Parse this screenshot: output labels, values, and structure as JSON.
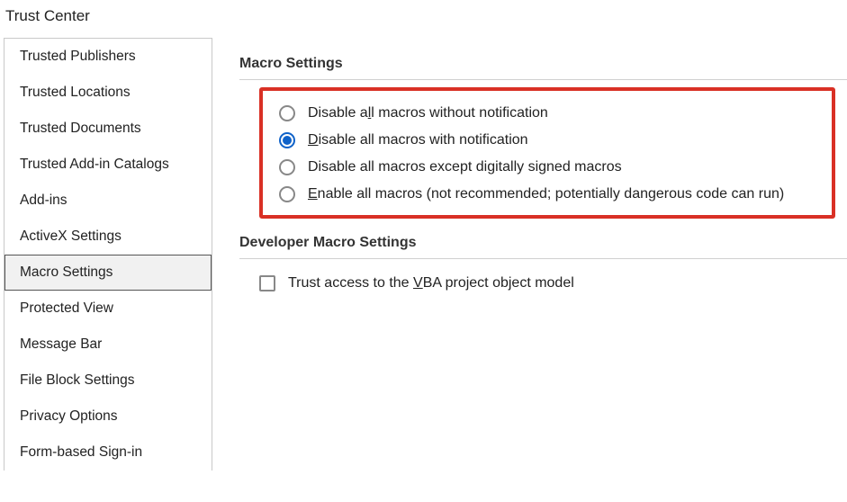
{
  "header": {
    "title": "Trust Center"
  },
  "sidebar": {
    "items": [
      {
        "label": "Trusted Publishers",
        "selected": false
      },
      {
        "label": "Trusted Locations",
        "selected": false
      },
      {
        "label": "Trusted Documents",
        "selected": false
      },
      {
        "label": "Trusted Add-in Catalogs",
        "selected": false
      },
      {
        "label": "Add-ins",
        "selected": false
      },
      {
        "label": "ActiveX Settings",
        "selected": false
      },
      {
        "label": "Macro Settings",
        "selected": true
      },
      {
        "label": "Protected View",
        "selected": false
      },
      {
        "label": "Message Bar",
        "selected": false
      },
      {
        "label": "File Block Settings",
        "selected": false
      },
      {
        "label": "Privacy Options",
        "selected": false
      },
      {
        "label": "Form-based Sign-in",
        "selected": false
      }
    ]
  },
  "main": {
    "section1_title": "Macro Settings",
    "radios": [
      {
        "pre": "Disable a",
        "hot": "l",
        "post": "l macros without notification",
        "checked": false
      },
      {
        "pre": "",
        "hot": "D",
        "post": "isable all macros with notification",
        "checked": true
      },
      {
        "pre": "Disable all macros except di",
        "hot": "g",
        "post": "itally signed macros",
        "checked": false
      },
      {
        "pre": "",
        "hot": "E",
        "post": "nable all macros (not recommended; potentially dangerous code can run)",
        "checked": false
      }
    ],
    "section2_title": "Developer Macro Settings",
    "checkbox": {
      "pre": "Trust access to the ",
      "hot": "V",
      "post": "BA project object model",
      "checked": false
    }
  }
}
